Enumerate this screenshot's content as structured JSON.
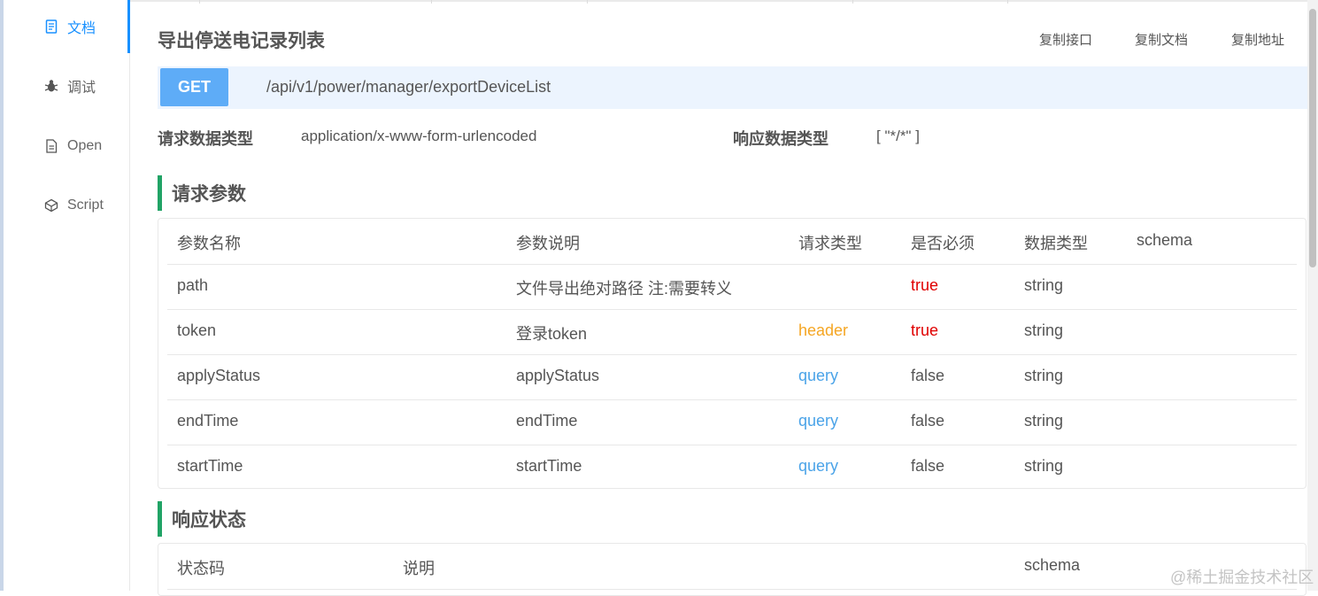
{
  "sidebar": {
    "items": [
      {
        "label": "文档",
        "icon": "document-icon",
        "active": true
      },
      {
        "label": "调试",
        "icon": "bug-icon",
        "active": false
      },
      {
        "label": "Open",
        "icon": "file-icon",
        "active": false
      },
      {
        "label": "Script",
        "icon": "code-cube-icon",
        "active": false
      }
    ]
  },
  "header": {
    "title": "导出停送电记录列表",
    "copy_interface": "复制接口",
    "copy_doc": "复制文档",
    "copy_address": "复制地址"
  },
  "api": {
    "method": "GET",
    "path": "/api/v1/power/manager/exportDeviceList"
  },
  "meta": {
    "request_type_label": "请求数据类型",
    "request_type_value": "application/x-www-form-urlencoded",
    "response_type_label": "响应数据类型",
    "response_type_value": "[ \"*/*\" ]"
  },
  "request_params": {
    "heading": "请求参数",
    "columns": [
      "参数名称",
      "参数说明",
      "请求类型",
      "是否必须",
      "数据类型",
      "schema"
    ],
    "rows": [
      {
        "name": "path",
        "desc": "文件导出绝对路径 注:需要转义",
        "in": "",
        "required": "true",
        "type": "string",
        "schema": ""
      },
      {
        "name": "token",
        "desc": "登录token",
        "in": "header",
        "required": "true",
        "type": "string",
        "schema": ""
      },
      {
        "name": "applyStatus",
        "desc": "applyStatus",
        "in": "query",
        "required": "false",
        "type": "string",
        "schema": ""
      },
      {
        "name": "endTime",
        "desc": "endTime",
        "in": "query",
        "required": "false",
        "type": "string",
        "schema": ""
      },
      {
        "name": "startTime",
        "desc": "startTime",
        "in": "query",
        "required": "false",
        "type": "string",
        "schema": ""
      }
    ]
  },
  "response_status": {
    "heading": "响应状态",
    "columns": [
      "状态码",
      "说明",
      "schema"
    ]
  },
  "colors": {
    "accent": "#1890ff",
    "method_bg": "#5eacf7",
    "api_bar_bg": "#ecf4fe",
    "section_bar": "#21a366",
    "required_true": "#e00000",
    "in_header": "#f5a623",
    "in_query": "#4aa3e8"
  },
  "watermark": "@稀土掘金技术社区"
}
